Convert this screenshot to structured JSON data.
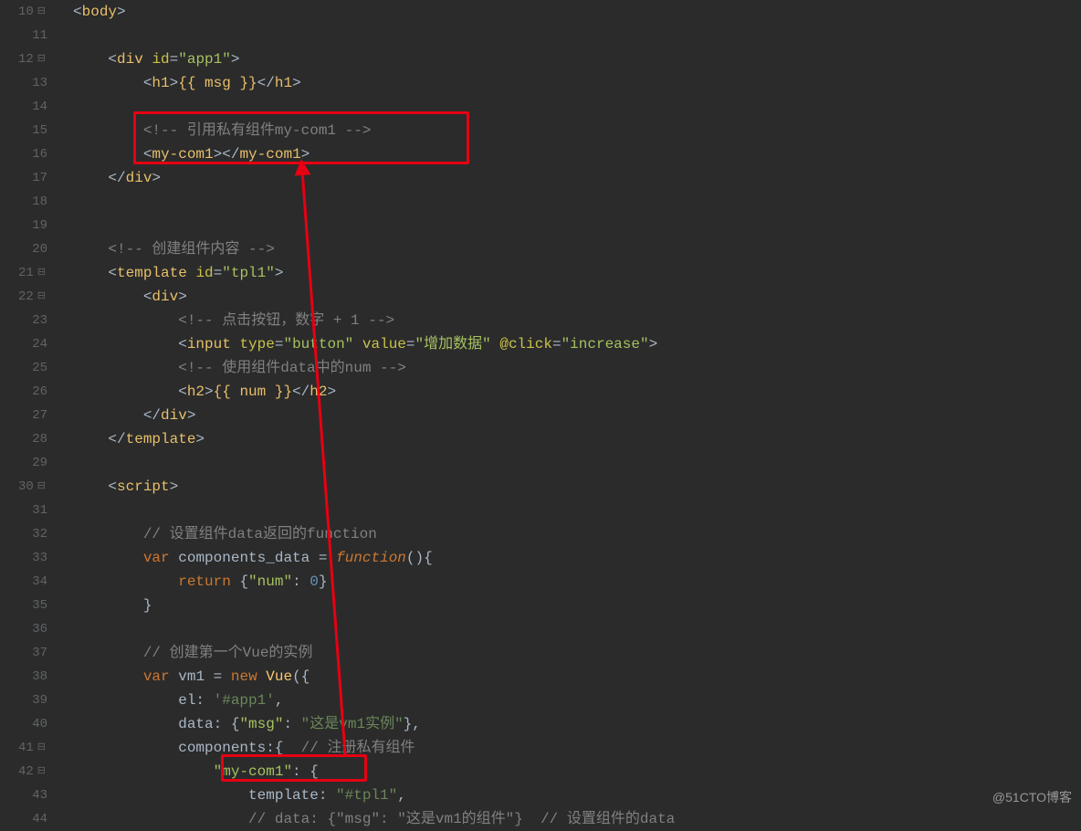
{
  "gutter": {
    "lines": [
      "10",
      "11",
      "12",
      "13",
      "14",
      "15",
      "16",
      "17",
      "18",
      "19",
      "20",
      "21",
      "22",
      "23",
      "24",
      "25",
      "26",
      "27",
      "28",
      "29",
      "30",
      "31",
      "32",
      "33",
      "34",
      "35",
      "36",
      "37",
      "38",
      "39",
      "40",
      "41",
      "42",
      "43",
      "44"
    ],
    "fold_lines": [
      10,
      12,
      21,
      22,
      30,
      41,
      42
    ],
    "fold_glyph": "⊟"
  },
  "code": {
    "l10": {
      "tag1": "<body>",
      "body": "body"
    },
    "l12": {
      "div": "div",
      "id_attr": "id",
      "id_val": "\"app1\""
    },
    "l13": {
      "h1o": "h1",
      "bind": "{{ msg }}"
    },
    "l15": {
      "comment": "<!-- 引用私有组件my-com1 -->"
    },
    "l16": {
      "tag": "my-com1"
    },
    "l17": {
      "div": "div"
    },
    "l20": {
      "comment": "<!-- 创建组件内容 -->"
    },
    "l21": {
      "template": "template",
      "id_attr": "id",
      "id_val": "\"tpl1\""
    },
    "l22": {
      "div": "div"
    },
    "l23": {
      "comment": "<!-- 点击按钮，数字 + 1 -->"
    },
    "l24": {
      "input": "input",
      "type_attr": "type",
      "type_val": "\"button\"",
      "value_attr": "value",
      "value_val": "\"增加数据\"",
      "click_attr": "@click",
      "click_val": "\"increase\""
    },
    "l25": {
      "comment": "<!-- 使用组件data中的num -->"
    },
    "l26": {
      "h2": "h2",
      "bind": "{{ num }}"
    },
    "l27": {
      "div": "div"
    },
    "l28": {
      "template": "template"
    },
    "l30": {
      "script": "script"
    },
    "l32": {
      "comment": "// 设置组件data返回的function"
    },
    "l33": {
      "var": "var",
      "name": "components_data",
      "func": "function"
    },
    "l34": {
      "ret": "return",
      "key": "\"num\"",
      "val": "0"
    },
    "l37": {
      "comment": "// 创建第一个Vue的实例"
    },
    "l38": {
      "var": "var",
      "name": "vm1",
      "new": "new",
      "vue": "Vue"
    },
    "l39": {
      "el": "el",
      "val": "'#app1'"
    },
    "l40": {
      "data": "data",
      "key": "\"msg\"",
      "val": "\"这是vm1实例\""
    },
    "l41": {
      "components": "components",
      "comment": "// 注册私有组件"
    },
    "l42": {
      "key": "\"my-com1\""
    },
    "l43": {
      "template": "template",
      "val": "\"#tpl1\""
    },
    "l44": {
      "comment": "// data: {\"msg\": \"这是vm1的组件\"}  // 设置组件的data"
    }
  },
  "watermark": "@51CTO博客"
}
